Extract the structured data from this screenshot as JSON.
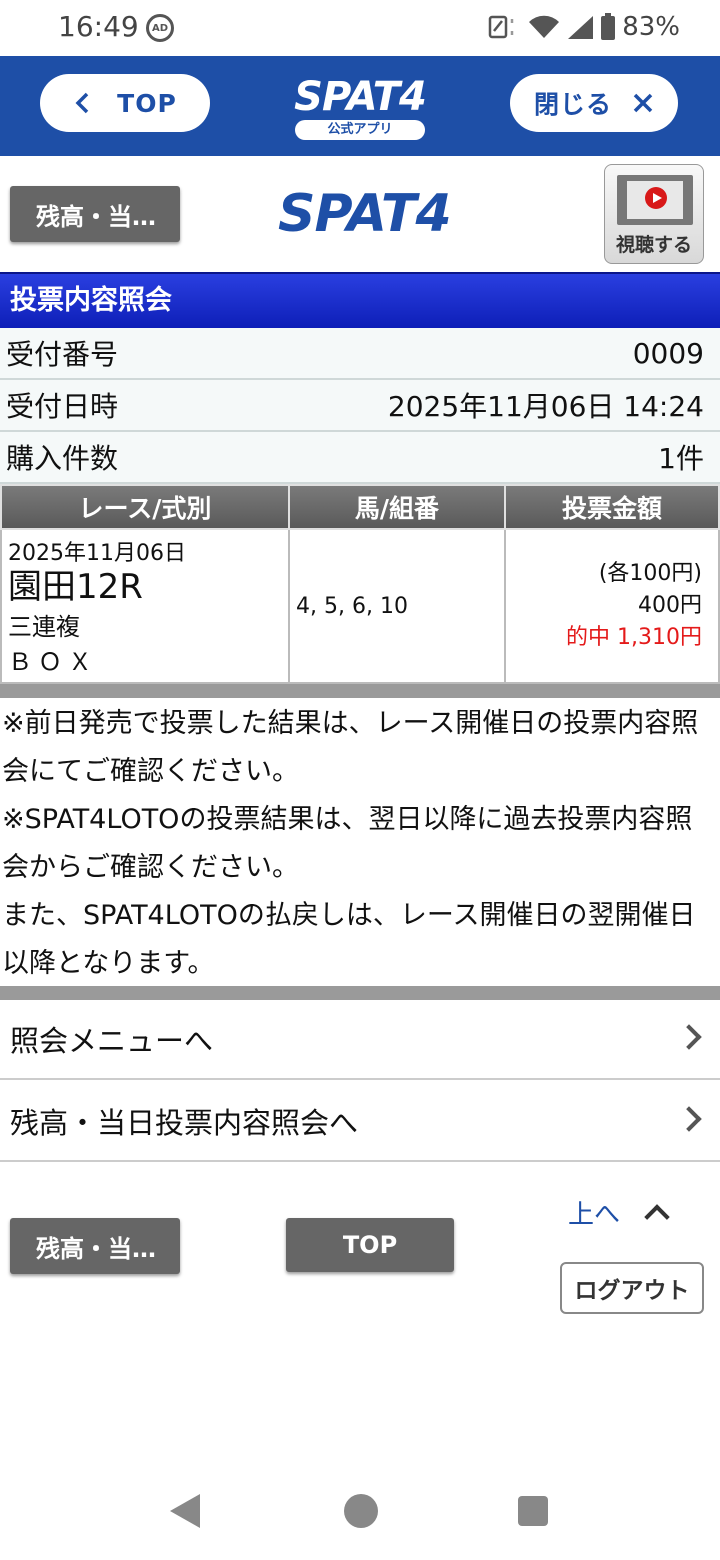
{
  "status_bar": {
    "time": "16:49",
    "ad_badge": "AD",
    "battery": "83%"
  },
  "app_header": {
    "top_label": "TOP",
    "close_label": "閉じる",
    "logo": "SPAT4",
    "logo_sub": "公式アプリ"
  },
  "page_header": {
    "back_label": "残高・当…",
    "site_logo": "SPAT4",
    "video_label": "視聴する"
  },
  "section_title": "投票内容照会",
  "info": {
    "receipt_no_label": "受付番号",
    "receipt_no": "0009",
    "receipt_dt_label": "受付日時",
    "receipt_dt": "2025年11月06日 14:24",
    "count_label": "購入件数",
    "count": "1件"
  },
  "table": {
    "headers": [
      "レース/式別",
      "馬/組番",
      "投票金額"
    ],
    "row": {
      "date": "2025年11月06日",
      "race": "園田12R",
      "bet_type": "三連複",
      "mode": "ＢＯＸ",
      "combo": "4, 5, 6, 10",
      "unit": "(各100円)",
      "total": "400円",
      "hit": "的中  1,310円"
    }
  },
  "notes": [
    "※前日発売で投票した結果は、レース開催日の投票内容照会にてご確認ください。",
    "※SPAT4LOTOの投票結果は、翌日以降に過去投票内容照会からご確認ください。",
    "また、SPAT4LOTOの払戻しは、レース開催日の翌開催日以降となります。"
  ],
  "menu": {
    "inquiry_menu": "照会メニューへ",
    "balance_inquiry": "残高・当日投票内容照会へ"
  },
  "footer": {
    "back_label": "残高・当…",
    "top_label": "TOP",
    "to_top": "上へ",
    "logout": "ログアウト"
  },
  "colors": {
    "brand_blue": "#1e4fa7",
    "section_blue": "#1a2ccf",
    "hit_red": "#e41a1a"
  },
  "icons": [
    "ad-icon",
    "nfc-icon",
    "wifi-icon",
    "signal-icon",
    "battery-icon",
    "chevron-left-icon",
    "close-icon",
    "play-icon",
    "chevron-right-icon",
    "chevron-up-icon",
    "nav-back-icon",
    "nav-home-icon",
    "nav-recent-icon"
  ]
}
